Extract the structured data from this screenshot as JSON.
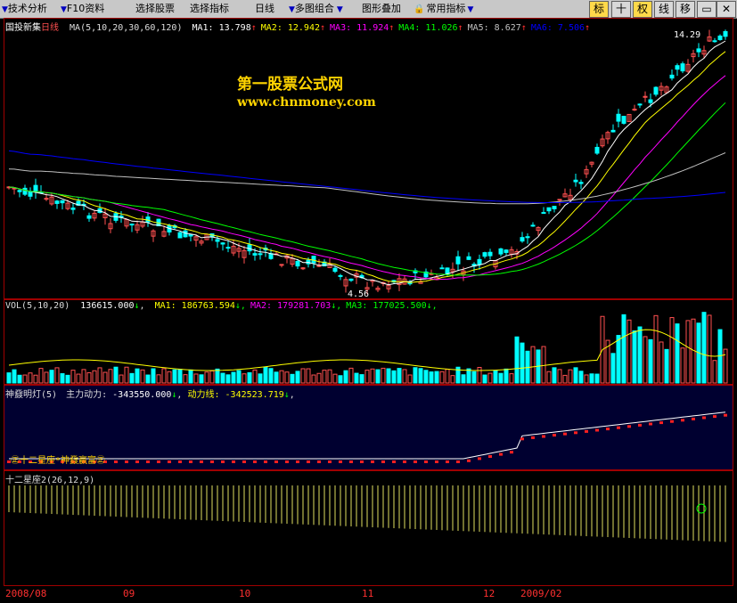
{
  "toolbar": {
    "items": [
      {
        "label": "技术分析",
        "has_arrow": true
      },
      {
        "label": "F10资料",
        "has_arrow": false
      },
      {
        "label": "选择股票",
        "has_arrow": false
      },
      {
        "label": "选择指标",
        "has_arrow": false
      },
      {
        "label": "日线",
        "has_arrow": false
      },
      {
        "label": "多图组合",
        "has_arrow": true
      },
      {
        "label": "图形叠加",
        "has_arrow": false
      },
      {
        "label": "常用指标",
        "has_arrow": true
      }
    ],
    "right_buttons": [
      "标",
      "十",
      "权",
      "线",
      "移"
    ]
  },
  "main_chart": {
    "stock_name": "国投新集",
    "period": "日线",
    "ma_params": "MA(5,10,20,30,60,120)",
    "ma_values": [
      {
        "label": "MA1:",
        "value": "13.798",
        "color": "#ffffff"
      },
      {
        "label": "MA2:",
        "value": "12.942",
        "color": "#ffff00"
      },
      {
        "label": "MA3:",
        "value": "11.924",
        "color": "#ff00ff"
      },
      {
        "label": "MA4:",
        "value": "11.026",
        "color": "#00ff00"
      },
      {
        "label": "MA5:",
        "value": "8.627",
        "color": "#c0c0c0"
      },
      {
        "label": "MA6:",
        "value": "7.506",
        "color": "#0000ff"
      }
    ],
    "high_label": "14.29",
    "low_label": "4.56",
    "watermark_title": "第一股票公式网",
    "watermark_url": "www.chnmoney.com"
  },
  "volume_panel": {
    "params": "VOL(5,10,20)",
    "vol_value": "136615.000",
    "ma_values": [
      {
        "label": "MA1:",
        "value": "186763.594",
        "color": "#ffff00"
      },
      {
        "label": "MA2:",
        "value": "179281.703",
        "color": "#ff00ff"
      },
      {
        "label": "MA3:",
        "value": "177025.500",
        "color": "#00ff00"
      }
    ]
  },
  "indicator_panel": {
    "name": "神鼗明灯(5)",
    "line1_label": "主力动力:",
    "line1_value": "-343550.000",
    "line2_label": "动力线:",
    "line2_value": "-342523.719",
    "footer_note": "㊣十二星座*神鼗赢富㊣"
  },
  "zodiac_panel": {
    "name": "十二星座2(26,12,9)"
  },
  "x_axis": {
    "labels": [
      "2008/08",
      "09",
      "10",
      "11",
      "12",
      "2009/02"
    ]
  },
  "colors": {
    "up": "#ff5050",
    "down": "#00ffff",
    "border": "#a00000",
    "indicator_bg": "#000030"
  }
}
